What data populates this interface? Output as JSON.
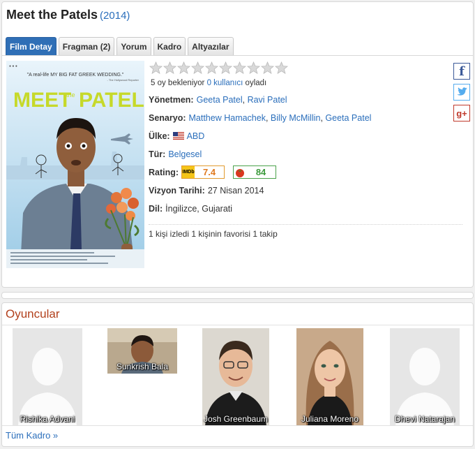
{
  "movie": {
    "title": "Meet the Patels",
    "year": "(2014)"
  },
  "tabs": [
    {
      "label": "Film Detay",
      "active": true
    },
    {
      "label": "Fragman (2)",
      "active": false
    },
    {
      "label": "Yorum",
      "active": false
    },
    {
      "label": "Kadro",
      "active": false
    },
    {
      "label": "Altyazılar",
      "active": false
    }
  ],
  "poster": {
    "quote": "\"A real-life MY BIG FAT GREEK WEDDING.\"",
    "quote_source": "- The Hollywood Reporter",
    "title_line1": "MEET",
    "title_small": "the",
    "title_line2": "PATELS"
  },
  "rating_widget": {
    "star_count": 10,
    "filled": 0,
    "votes_prefix": "5 oy bekleniyor",
    "voters_link": "0 kullanıcı",
    "votes_suffix": "oyladı"
  },
  "details": {
    "director_label": "Yönetmen:",
    "directors": [
      "Geeta Patel",
      "Ravi Patel"
    ],
    "writer_label": "Senaryo:",
    "writers": [
      "Matthew Hamachek",
      "Billy McMillin",
      "Geeta Patel"
    ],
    "country_label": "Ülke:",
    "country": "ABD",
    "genre_label": "Tür:",
    "genre": "Belgesel",
    "rating_label": "Rating:",
    "imdb_logo": "IMDb",
    "imdb_score": "7.4",
    "rt_score": "84",
    "release_label": "Vizyon Tarihi:",
    "release_date": "27 Nisan 2014",
    "language_label": "Dil:",
    "languages": "İngilizce, Gujarati"
  },
  "stats": "1 kişi izledi 1 kişinin favorisi 1 takip",
  "social": {
    "facebook": "f",
    "google_plus": "g+"
  },
  "cast": {
    "heading": "Oyuncular",
    "members": [
      {
        "name": "Rishika Advani",
        "has_photo": false
      },
      {
        "name": "Sunkrish Bala",
        "has_photo": true
      },
      {
        "name": "Josh Greenbaum",
        "has_photo": true
      },
      {
        "name": "Juliana Moreno",
        "has_photo": true
      },
      {
        "name": "Dhevi Natarajan",
        "has_photo": false
      }
    ],
    "all_link": "Tüm Kadro »"
  },
  "colors": {
    "accent_blue": "#2f6fb6",
    "link": "#2a6ebb",
    "section_heading": "#b2401c",
    "imdb_orange": "#e07a1f",
    "rt_green": "#3c9a3c"
  }
}
